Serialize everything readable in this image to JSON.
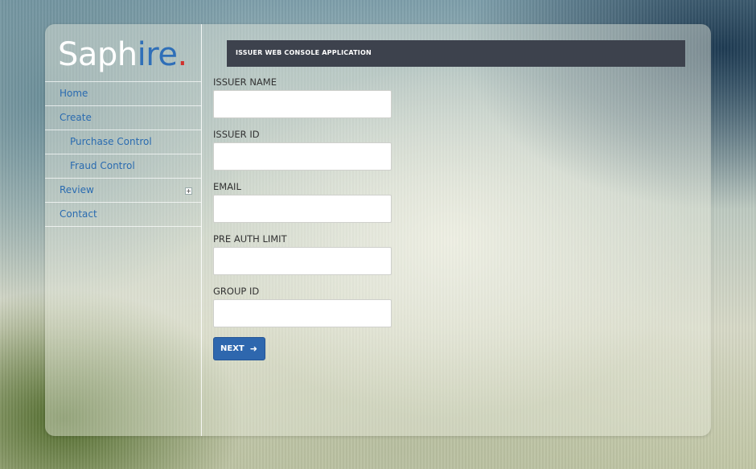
{
  "logo": {
    "part1": "Saph",
    "part2": "ire",
    "dot": "."
  },
  "nav": {
    "home": "Home",
    "create": "Create",
    "purchase_control": "Purchase Control",
    "fraud_control": "Fraud Control",
    "review": "Review",
    "review_expand": "+",
    "contact": "Contact"
  },
  "header": {
    "title": "ISSUER WEB CONSOLE APPLICATION"
  },
  "form": {
    "fields": [
      {
        "label": "ISSUER NAME",
        "value": ""
      },
      {
        "label": "ISSUER ID",
        "value": ""
      },
      {
        "label": "EMAIL",
        "value": ""
      },
      {
        "label": "PRE AUTH LIMIT",
        "value": ""
      },
      {
        "label": "GROUP ID",
        "value": ""
      }
    ],
    "next_label": "NEXT",
    "next_icon": "arrow-right-icon"
  },
  "colors": {
    "accent": "#2e67ae",
    "link": "#2a6bb0",
    "header_bg": "#3d424d",
    "logo_red": "#d0312d"
  }
}
